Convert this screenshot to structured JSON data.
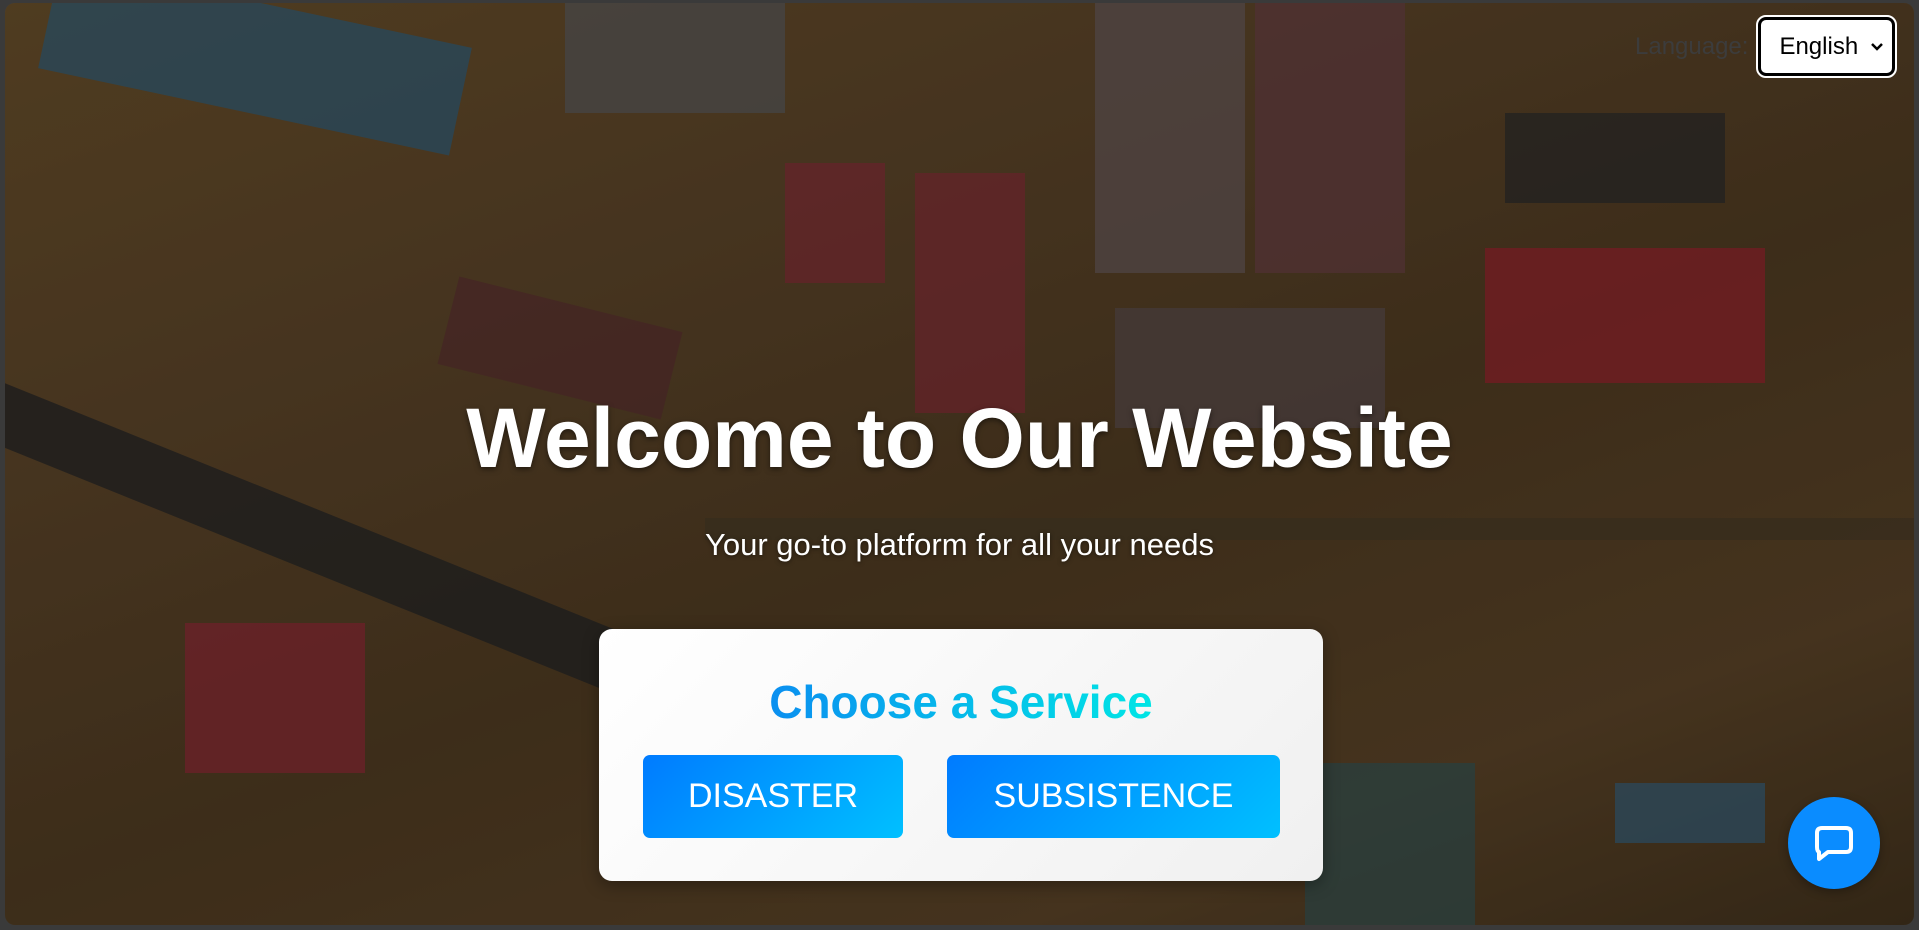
{
  "hero": {
    "title": "Welcome to Our Website",
    "subtitle": "Your go-to platform for all your needs"
  },
  "service_card": {
    "heading": "Choose a Service",
    "buttons": [
      {
        "label": "DISASTER"
      },
      {
        "label": "SUBSISTENCE"
      }
    ]
  },
  "language": {
    "label": "Language:",
    "selected": "English"
  },
  "chat": {
    "icon": "chat-bubble-icon"
  },
  "colors": {
    "button_start": "#007bff",
    "button_end": "#00c0ff",
    "heading_start": "#0a8ff0",
    "heading_end": "#00e5e5",
    "chat": "#0a8cff"
  }
}
